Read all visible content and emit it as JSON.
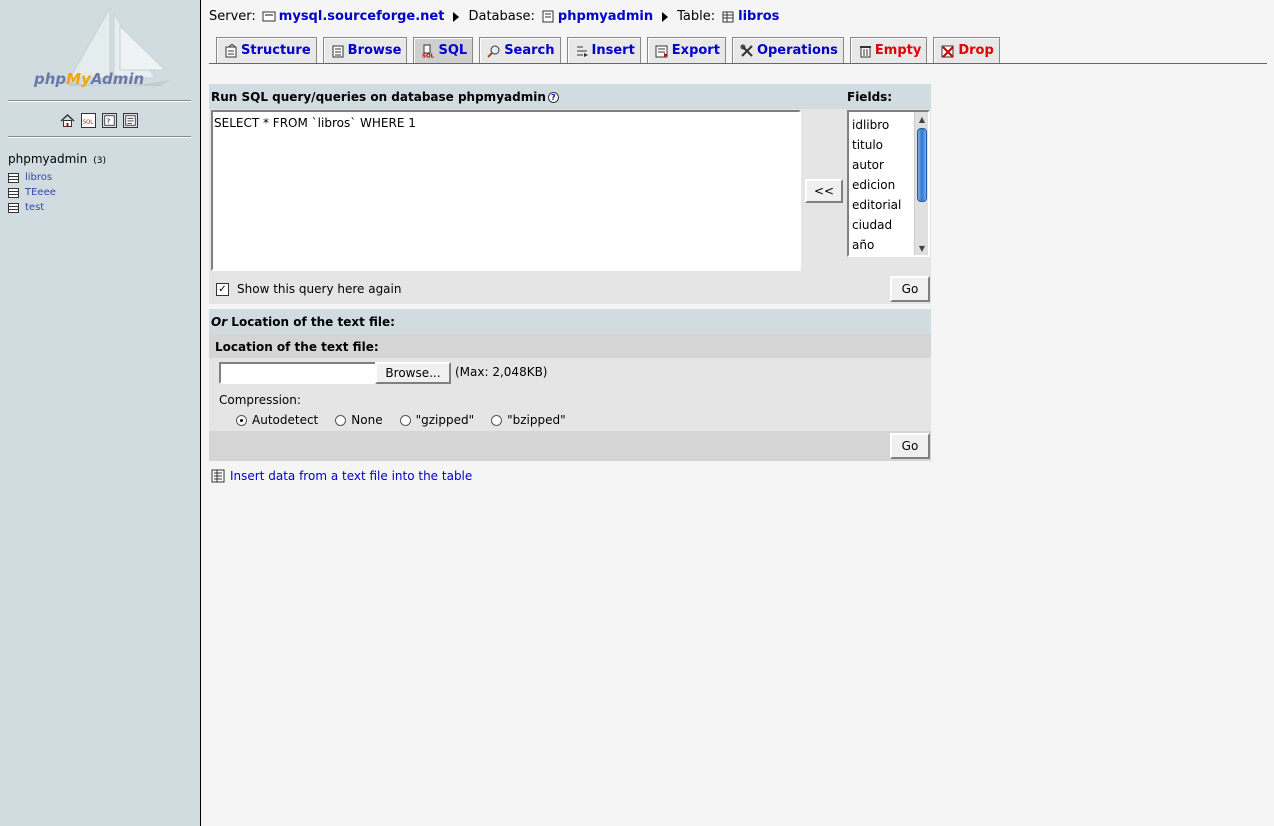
{
  "sidebar": {
    "logo": {
      "part1": "php",
      "part2": "My",
      "part3": "Admin"
    },
    "icons": [
      "home-icon",
      "sql-icon",
      "query-window-icon",
      "docs-icon"
    ],
    "database": {
      "name": "phpmyadmin",
      "count": "(3)"
    },
    "tables": [
      {
        "label": "libros"
      },
      {
        "label": "TEeee"
      },
      {
        "label": "test"
      }
    ]
  },
  "breadcrumb": {
    "server_label": "Server:",
    "server": "mysql.sourceforge.net",
    "database_label": "Database:",
    "database": "phpmyadmin",
    "table_label": "Table:",
    "table": "libros"
  },
  "tabs": [
    {
      "label": "Structure",
      "icon": "structure-icon"
    },
    {
      "label": "Browse",
      "icon": "browse-icon"
    },
    {
      "label": "SQL",
      "icon": "sql-icon",
      "active": true
    },
    {
      "label": "Search",
      "icon": "search-icon"
    },
    {
      "label": "Insert",
      "icon": "insert-icon"
    },
    {
      "label": "Export",
      "icon": "export-icon"
    },
    {
      "label": "Operations",
      "icon": "operations-icon"
    },
    {
      "label": "Empty",
      "icon": "empty-icon",
      "color": "#e00000"
    },
    {
      "label": "Drop",
      "icon": "drop-icon",
      "color": "#e00000"
    }
  ],
  "sql": {
    "title": "Run SQL query/queries on database phpmyadmin",
    "help_glyph": "?",
    "fields_label": "Fields:",
    "query": "SELECT * FROM `libros` WHERE 1",
    "insert_button": "<<",
    "fields": [
      "idlibro",
      "titulo",
      "autor",
      "edicion",
      "editorial",
      "ciudad",
      "año"
    ],
    "show_again_label": "Show this query here again",
    "show_again_checked": true,
    "go_label": "Go"
  },
  "file": {
    "title_or": "Or",
    "title": " Location of the text file:",
    "location_label": "Location of the text file:",
    "browse_label": "Browse...",
    "max_size": "(Max: 2,048KB)",
    "compression_label": "Compression:",
    "options": [
      {
        "label": "Autodetect",
        "selected": true
      },
      {
        "label": "None",
        "selected": false
      },
      {
        "label": "\"gzipped\"",
        "selected": false
      },
      {
        "label": "\"bzipped\"",
        "selected": false
      }
    ],
    "go_label": "Go"
  },
  "insert_link": "Insert data from a text file into the table",
  "colors": {
    "sidebar_bg": "#d0dce0",
    "link": "#0000cc",
    "danger": "#e00000"
  }
}
